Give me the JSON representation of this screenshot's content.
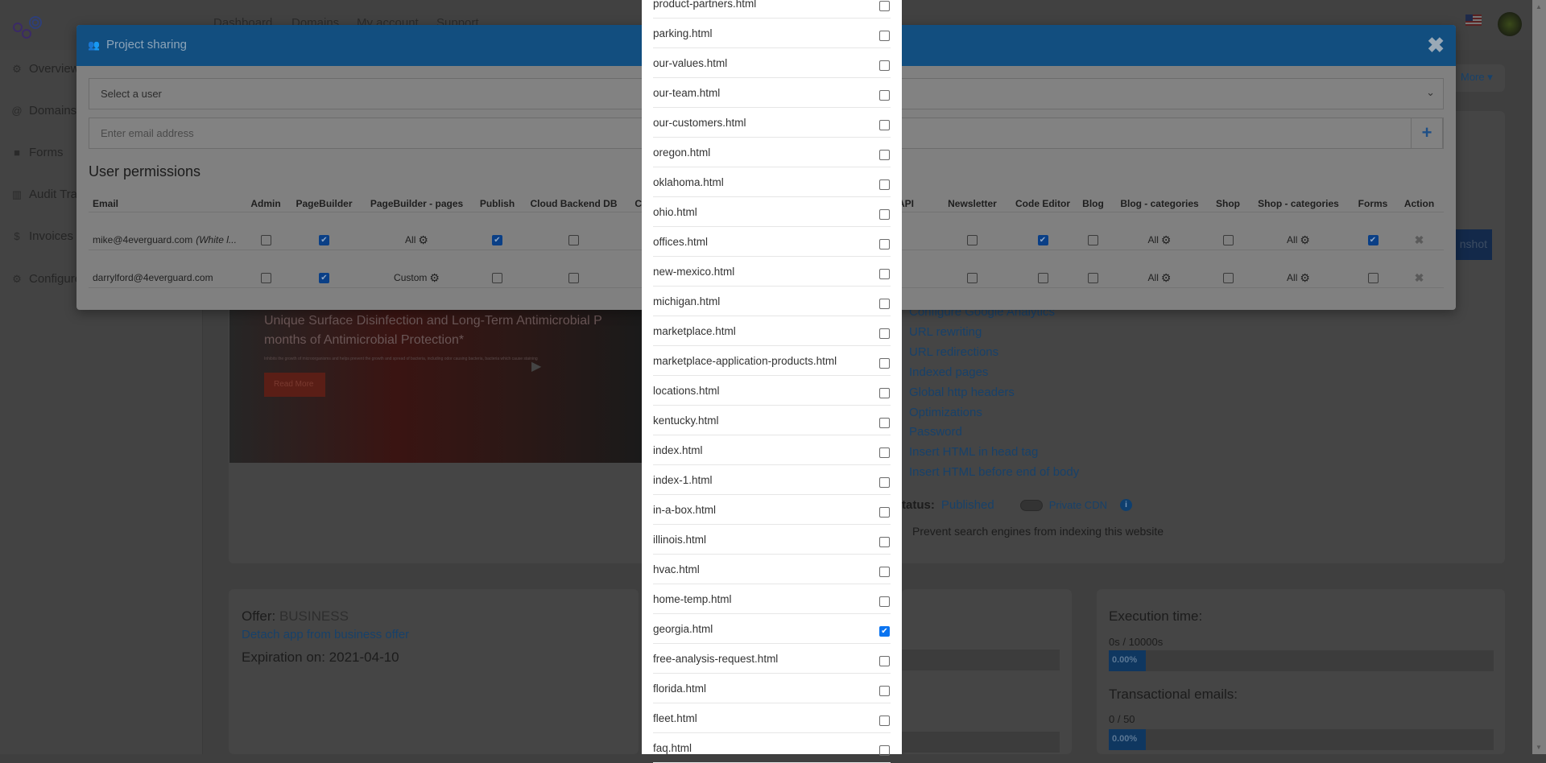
{
  "topnav": [
    "Dashboard",
    "Domains",
    "My account",
    "Support"
  ],
  "sidebar": {
    "items": [
      {
        "label": "Overview",
        "icon": "gear-icon"
      },
      {
        "label": "Domains",
        "icon": "at-icon"
      },
      {
        "label": "Forms",
        "icon": "folder-icon"
      },
      {
        "label": "Audit Trail",
        "icon": "chart-icon"
      },
      {
        "label": "Invoices",
        "icon": "dollar-icon"
      },
      {
        "label": "Configure",
        "icon": "gears-icon"
      }
    ]
  },
  "background": {
    "more_label": "More ▾",
    "screenshot_fragment": "nshot",
    "hero": {
      "line1": "Unique Surface Disinfection and Long-Term Antimicrobial P",
      "line2": "months of Antimicrobial Protection*",
      "small": "Inhibits the growth of microorganisms and helps prevent the growth and spread of bacteria, including odor causing bacteria, bacteria which cause staining",
      "button": "Read More"
    },
    "links": [
      "Configure Google Analytics",
      "URL rewriting",
      "URL redirections",
      "Indexed pages",
      "Global http headers",
      "Optimizations",
      "Password",
      "Insert HTML in head tag",
      "Insert HTML before end of body"
    ],
    "status_label": "tatus:",
    "status_value": "Published",
    "private_cdn": "Private CDN",
    "prevent_label": "Prevent search engines from indexing this website",
    "offer_label": "Offer:",
    "offer_value": "BUSINESS",
    "detach_link": "Detach app from business offer",
    "expiration": "Expiration on: 2021-04-10",
    "execution_title": "Execution time:",
    "execution_value": "0s / 10000s",
    "execution_pct": "0.00%",
    "emails_title": "Transactional emails:",
    "emails_value": "0 / 50",
    "emails_pct": "0.00%"
  },
  "modal": {
    "title": "Project sharing",
    "select_placeholder": "Select a user",
    "email_placeholder": "Enter email address",
    "add_label": "+",
    "permissions_title": "User permissions",
    "columns": [
      "Email",
      "Admin",
      "PageBuilder",
      "PageBuilder - pages",
      "Publish",
      "Cloud Backend DB",
      "Cr",
      "d API",
      "Newsletter",
      "Code Editor",
      "Blog",
      "Blog - categories",
      "Shop",
      "Shop - categories",
      "Forms",
      "Action"
    ],
    "rows": [
      {
        "email": "mike@4everguard.com",
        "note": "(White l...",
        "cells": [
          false,
          true,
          "All",
          true,
          false,
          null,
          null,
          false,
          true,
          false,
          "All",
          false,
          "All",
          true,
          "x"
        ]
      },
      {
        "email": "darrylford@4everguard.com",
        "note": "",
        "cells": [
          false,
          true,
          "Custom",
          false,
          false,
          null,
          null,
          false,
          false,
          false,
          "All",
          false,
          "All",
          false,
          "x"
        ]
      }
    ]
  },
  "pages_list": [
    {
      "name": "product-partners.html",
      "checked": false
    },
    {
      "name": "parking.html",
      "checked": false
    },
    {
      "name": "our-values.html",
      "checked": false
    },
    {
      "name": "our-team.html",
      "checked": false
    },
    {
      "name": "our-customers.html",
      "checked": false
    },
    {
      "name": "oregon.html",
      "checked": false
    },
    {
      "name": "oklahoma.html",
      "checked": false
    },
    {
      "name": "ohio.html",
      "checked": false
    },
    {
      "name": "offices.html",
      "checked": false
    },
    {
      "name": "new-mexico.html",
      "checked": false
    },
    {
      "name": "michigan.html",
      "checked": false
    },
    {
      "name": "marketplace.html",
      "checked": false
    },
    {
      "name": "marketplace-application-products.html",
      "checked": false
    },
    {
      "name": "locations.html",
      "checked": false
    },
    {
      "name": "kentucky.html",
      "checked": false
    },
    {
      "name": "index.html",
      "checked": false
    },
    {
      "name": "index-1.html",
      "checked": false
    },
    {
      "name": "in-a-box.html",
      "checked": false
    },
    {
      "name": "illinois.html",
      "checked": false
    },
    {
      "name": "hvac.html",
      "checked": false
    },
    {
      "name": "home-temp.html",
      "checked": false
    },
    {
      "name": "georgia.html",
      "checked": true
    },
    {
      "name": "free-analysis-request.html",
      "checked": false
    },
    {
      "name": "florida.html",
      "checked": false
    },
    {
      "name": "fleet.html",
      "checked": false
    },
    {
      "name": "faq.html",
      "checked": false
    }
  ]
}
